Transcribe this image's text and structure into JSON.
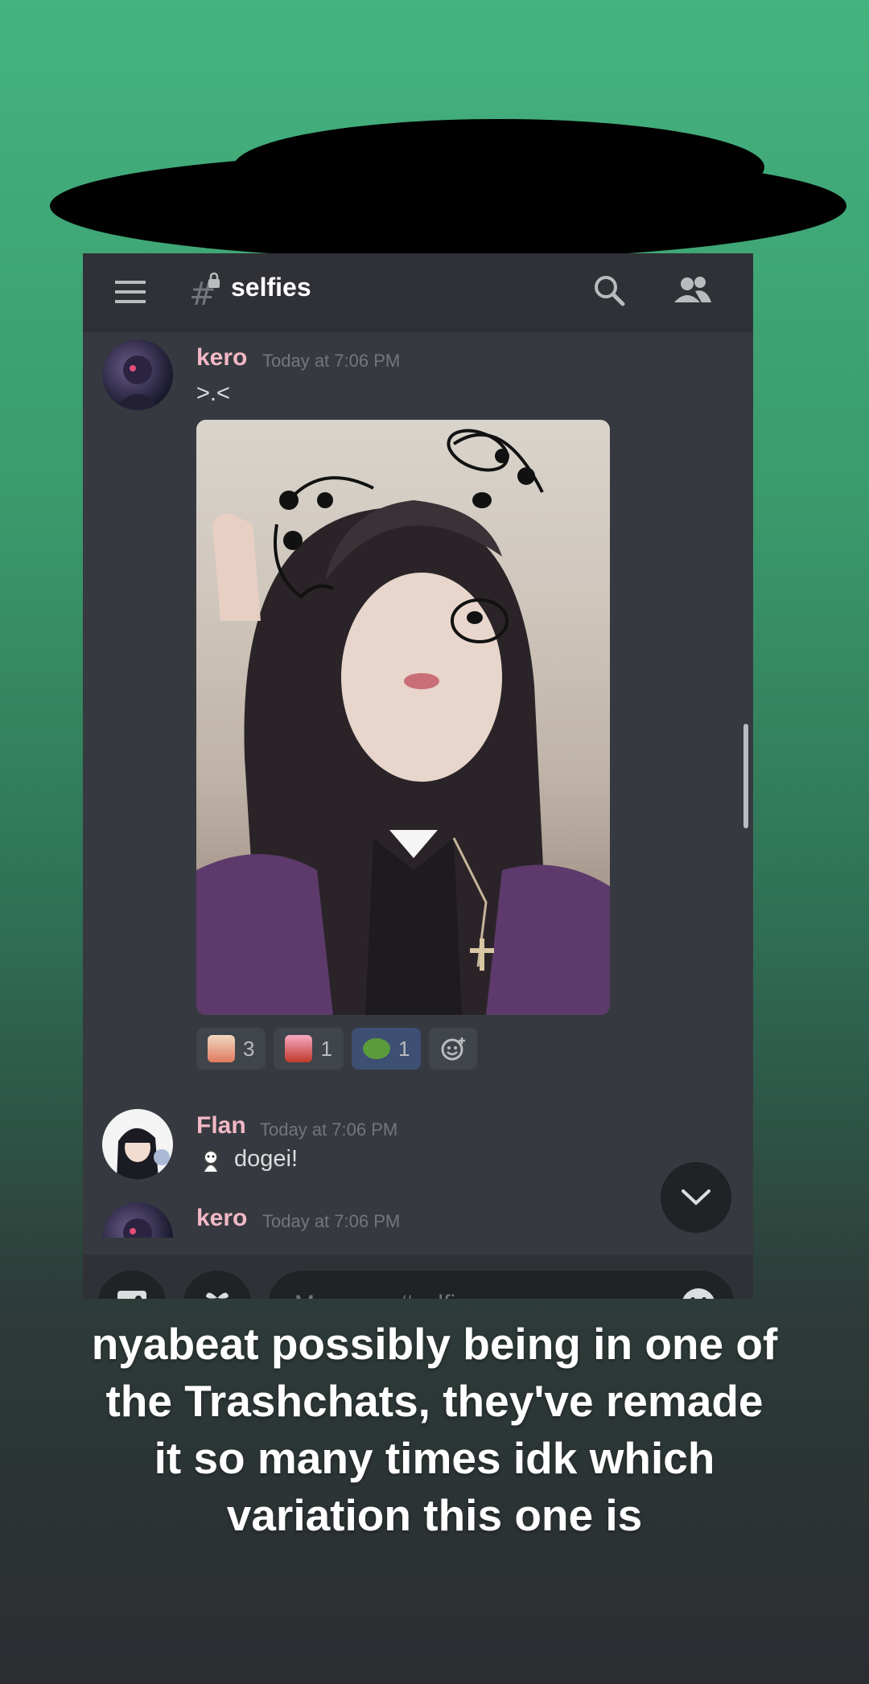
{
  "header": {
    "channel_name": "selfies",
    "menu_icon": "hamburger-menu-icon",
    "channel_icon": "locked-hash-icon",
    "search_icon": "search-icon",
    "members_icon": "members-icon"
  },
  "messages": [
    {
      "author": "kero",
      "author_color": "#f2b8c6",
      "timestamp": "Today at 7:06 PM",
      "text": ">.<",
      "attachment": "selfie-photo",
      "reactions": [
        {
          "emoji": "anime-girl-emoji",
          "count": "3"
        },
        {
          "emoji": "pink-anime-emoji",
          "count": "1"
        },
        {
          "emoji": "pepe-frog-emoji",
          "count": "1"
        }
      ]
    },
    {
      "author": "Flan",
      "author_color": "#f2b8c6",
      "timestamp": "Today at 7:06 PM",
      "text": "dogei!",
      "emoji": "dog-doodle-emoji"
    },
    {
      "author": "kero",
      "author_color": "#f2b8c6",
      "timestamp": "Today at 7:06 PM"
    }
  ],
  "composer": {
    "placeholder": "Message #selfies",
    "image_icon": "image-icon",
    "gift_icon": "gift-icon",
    "emoji_icon": "smiley-icon"
  },
  "caption": {
    "lines": [
      "nyabeat possibly being in one of",
      "the Trashchats, they've remade",
      "it so many times idk which",
      "variation this one is"
    ]
  },
  "colors": {
    "bg_top": "#45b37f",
    "bg_bottom": "#2b2d31",
    "chat_bg": "#36393f",
    "bar_bg": "#2f3136",
    "author": "#f2b8c6"
  }
}
